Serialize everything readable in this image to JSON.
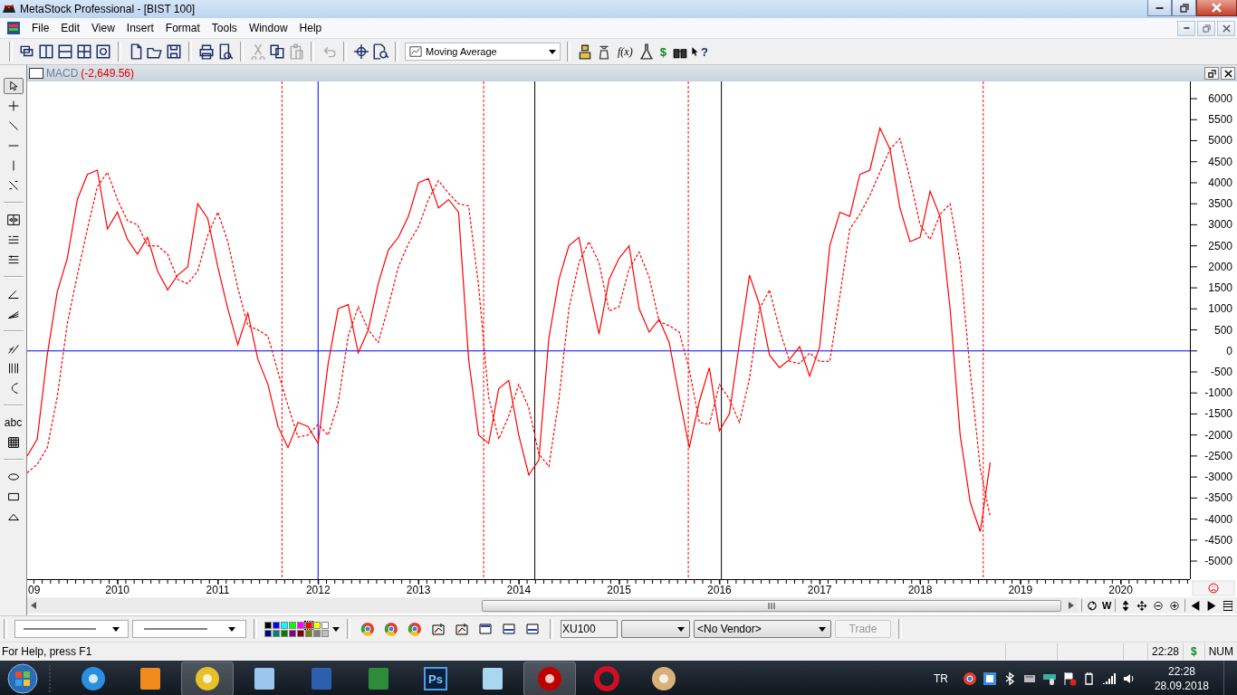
{
  "window": {
    "title": "MetaStock Professional - [BIST 100]"
  },
  "menu": [
    "File",
    "Edit",
    "View",
    "Insert",
    "Format",
    "Tools",
    "Window",
    "Help"
  ],
  "toolbar": {
    "indicator": "Moving Average",
    "function_glyph": "f(x)",
    "currency_glyph": "$",
    "help_glyph": "?"
  },
  "drawing_tools": [
    [
      {
        "kind": "pointer",
        "selected": true
      },
      {
        "kind": "crosshair",
        "selected": false
      },
      {
        "kind": "trendline",
        "selected": false
      },
      {
        "kind": "horizontal",
        "selected": false
      },
      {
        "kind": "vertical",
        "selected": false
      },
      {
        "kind": "speed",
        "selected": false
      }
    ],
    [
      {
        "kind": "scroll",
        "selected": false
      },
      {
        "kind": "raff",
        "selected": false
      },
      {
        "kind": "tirone",
        "selected": false
      }
    ],
    [
      {
        "kind": "angle",
        "selected": false
      },
      {
        "kind": "fan",
        "selected": false
      }
    ],
    [
      {
        "kind": "parallel",
        "selected": false
      },
      {
        "kind": "cycle",
        "selected": false
      },
      {
        "kind": "arc",
        "selected": false
      }
    ],
    [
      {
        "kind": "text",
        "label": "abc",
        "selected": false
      },
      {
        "kind": "table",
        "selected": false
      }
    ],
    [
      {
        "kind": "ellipse",
        "selected": false
      },
      {
        "kind": "rectangle",
        "selected": false
      },
      {
        "kind": "triangle",
        "selected": false
      }
    ]
  ],
  "chart_window": {
    "title": "MACD",
    "reading": "(-2,649.56)",
    "axis_edge_label": "09",
    "chart_data": {
      "type": "line",
      "x": [
        2009.1,
        2009.2,
        2009.3,
        2009.4,
        2009.5,
        2009.6,
        2009.7,
        2009.8,
        2009.9,
        2010.0,
        2010.1,
        2010.2,
        2010.3,
        2010.4,
        2010.5,
        2010.6,
        2010.7,
        2010.8,
        2010.9,
        2011.0,
        2011.1,
        2011.2,
        2011.3,
        2011.4,
        2011.5,
        2011.6,
        2011.7,
        2011.8,
        2011.9,
        2012.0,
        2012.1,
        2012.2,
        2012.3,
        2012.4,
        2012.5,
        2012.6,
        2012.7,
        2012.8,
        2012.9,
        2013.0,
        2013.1,
        2013.2,
        2013.3,
        2013.4,
        2013.5,
        2013.6,
        2013.7,
        2013.8,
        2013.9,
        2014.0,
        2014.1,
        2014.2,
        2014.3,
        2014.4,
        2014.5,
        2014.6,
        2014.7,
        2014.8,
        2014.9,
        2015.0,
        2015.1,
        2015.2,
        2015.3,
        2015.4,
        2015.5,
        2015.6,
        2015.7,
        2015.8,
        2015.9,
        2016.0,
        2016.1,
        2016.2,
        2016.3,
        2016.4,
        2016.5,
        2016.6,
        2016.7,
        2016.8,
        2016.9,
        2017.0,
        2017.1,
        2017.2,
        2017.3,
        2017.4,
        2017.5,
        2017.6,
        2017.7,
        2017.8,
        2017.9,
        2018.0,
        2018.1,
        2018.2,
        2018.3,
        2018.4,
        2018.5,
        2018.6,
        2018.7
      ],
      "series": [
        {
          "color": "#ff0000",
          "line_style": "solid",
          "values": [
            -2500,
            -2100,
            -100,
            1400,
            2200,
            3600,
            4200,
            4300,
            2900,
            3300,
            2650,
            2300,
            2700,
            1900,
            1450,
            1800,
            2000,
            3500,
            3150,
            2000,
            1000,
            150,
            900,
            -200,
            -800,
            -1800,
            -2300,
            -1700,
            -1800,
            -2200,
            -300,
            1000,
            1100,
            -50,
            500,
            1600,
            2400,
            2700,
            3200,
            4000,
            4100,
            3400,
            3600,
            3300,
            -200,
            -2000,
            -2200,
            -900,
            -700,
            -2000,
            -2950,
            -2600,
            300,
            1700,
            2500,
            2700,
            1500,
            400,
            1700,
            2200,
            2500,
            1000,
            450,
            750,
            200,
            -1100,
            -2300,
            -1200,
            -400,
            -1900,
            -1500,
            200,
            1800,
            1100,
            -100,
            -400,
            -200,
            100,
            -600,
            100,
            2500,
            3300,
            3200,
            4200,
            4300,
            5300,
            4800,
            3400,
            2600,
            2700,
            3800,
            3200,
            1000,
            -2000,
            -3600,
            -4300,
            -2650
          ]
        },
        {
          "color": "#ff0000",
          "line_style": "dashed",
          "values": [
            -2900,
            -2700,
            -2300,
            -1100,
            650,
            1800,
            2900,
            3900,
            4250,
            3600,
            3100,
            3000,
            2500,
            2500,
            2300,
            1700,
            1600,
            1900,
            2750,
            3300,
            2600,
            1500,
            600,
            500,
            350,
            -500,
            -1300,
            -2050,
            -2000,
            -1750,
            -2000,
            -1250,
            350,
            1050,
            500,
            200,
            1050,
            2000,
            2550,
            2950,
            3600,
            4050,
            3750,
            3500,
            3450,
            1550,
            -1100,
            -2100,
            -1550,
            -800,
            -1350,
            -2450,
            -2750,
            -1150,
            1000,
            2100,
            2600,
            2100,
            950,
            1050,
            1950,
            2350,
            1750,
            700,
            600,
            450,
            -450,
            -1700,
            -1750,
            -800,
            -1150,
            -1700,
            -650,
            1000,
            1450,
            500,
            -250,
            -300,
            -50,
            -250,
            -250,
            1300,
            2900,
            3250,
            3700,
            4250,
            4800,
            5050,
            4100,
            3000,
            2650,
            3250,
            3500,
            2100,
            -500,
            -2800,
            -3950
          ]
        }
      ],
      "xlim": [
        2009.1,
        2020.69
      ],
      "ylim": [
        -5430,
        6410
      ],
      "xticks": [
        2010,
        2011,
        2012,
        2013,
        2014,
        2015,
        2016,
        2017,
        2018,
        2019,
        2020
      ],
      "yticks": [
        6000,
        5500,
        5000,
        4500,
        4000,
        3500,
        3000,
        2500,
        2000,
        1500,
        1000,
        500,
        0,
        -500,
        -1000,
        -1500,
        -2000,
        -2500,
        -3000,
        -3500,
        -4000,
        -4500,
        -5000
      ],
      "ref_lines": [
        {
          "axis": "x",
          "value": 2011.64,
          "color": "#ff0000",
          "line_style": "dashed"
        },
        {
          "axis": "x",
          "value": 2012.0,
          "color": "#0000ff",
          "line_style": "solid"
        },
        {
          "axis": "x",
          "value": 2013.65,
          "color": "#ff0000",
          "line_style": "dashed"
        },
        {
          "axis": "x",
          "value": 2014.16,
          "color": "#000000",
          "line_style": "solid"
        },
        {
          "axis": "x",
          "value": 2015.69,
          "color": "#ff0000",
          "line_style": "dashed"
        },
        {
          "axis": "x",
          "value": 2016.02,
          "color": "#000000",
          "line_style": "solid"
        },
        {
          "axis": "x",
          "value": 2018.63,
          "color": "#ff0000",
          "line_style": "dashed"
        },
        {
          "axis": "y",
          "value": 0,
          "color": "#0000ff",
          "line_style": "solid"
        }
      ]
    }
  },
  "scroll_nav": {
    "week_glyph": "W"
  },
  "bottom_toolbar": {
    "palette": [
      {
        "color": "#000000",
        "selected": false
      },
      {
        "color": "#0000ff",
        "selected": false
      },
      {
        "color": "#00ffff",
        "selected": false
      },
      {
        "color": "#00ff00",
        "selected": false
      },
      {
        "color": "#ff00ff",
        "selected": false
      },
      {
        "color": "#ff0000",
        "selected": true
      },
      {
        "color": "#ffff00",
        "selected": false
      },
      {
        "color": "#ffffff",
        "selected": false
      },
      {
        "color": "#000080",
        "selected": false
      },
      {
        "color": "#008080",
        "selected": false
      },
      {
        "color": "#008000",
        "selected": false
      },
      {
        "color": "#800080",
        "selected": false
      },
      {
        "color": "#800000",
        "selected": false
      },
      {
        "color": "#808000",
        "selected": false
      },
      {
        "color": "#808080",
        "selected": false
      },
      {
        "color": "#c0c0c0",
        "selected": false
      }
    ],
    "symbol": "XU100",
    "vendor": "<No Vendor>",
    "trade_button": {
      "label": "Trade",
      "disabled": true
    }
  },
  "status_bar": {
    "help": "For Help, press F1",
    "time": "22:28",
    "currency": "$",
    "num": "NUM"
  },
  "taskbar": {
    "apps": [
      {
        "kind": "ie",
        "running": false
      },
      {
        "kind": "media",
        "running": false
      },
      {
        "kind": "chrome",
        "running": true
      },
      {
        "kind": "calculator",
        "running": false
      },
      {
        "kind": "word",
        "running": false
      },
      {
        "kind": "excel",
        "running": false
      },
      {
        "kind": "photoshop",
        "label": "Ps",
        "running": false
      },
      {
        "kind": "notepad",
        "running": false
      },
      {
        "kind": "metastock",
        "running": true
      },
      {
        "kind": "opera",
        "running": false
      },
      {
        "kind": "paint",
        "running": false
      }
    ],
    "language": "TR",
    "time": "22:28",
    "date": "28.09.2018"
  }
}
